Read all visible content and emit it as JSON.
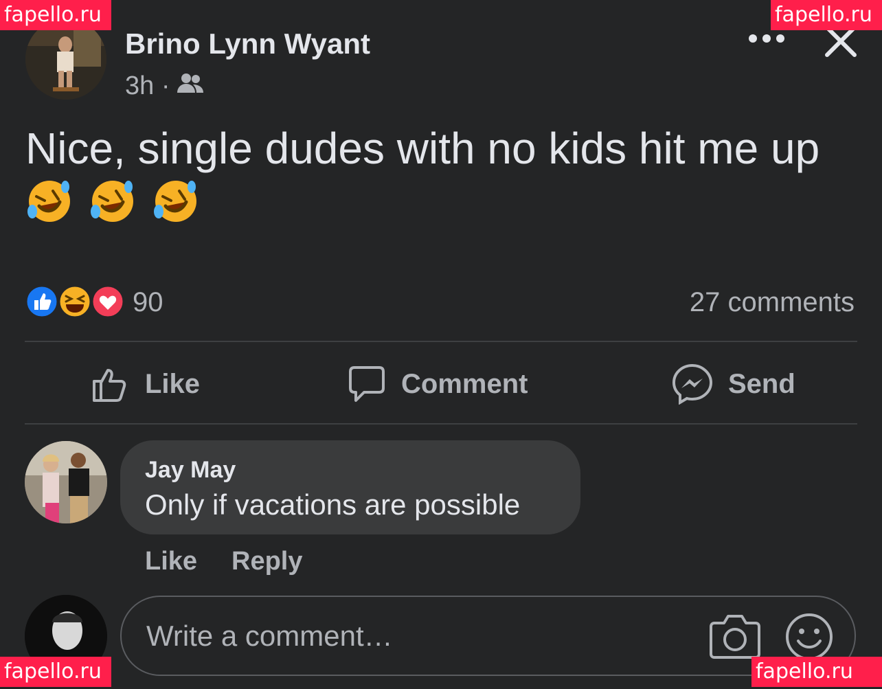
{
  "watermark": "fapello.ru",
  "post": {
    "author": "Brino Lynn Wyant",
    "time": "3h ·",
    "audience_icon": "friends-icon",
    "text": "Nice, single dudes with no kids hit me up",
    "emojis": [
      "rolling-on-floor-laughing",
      "rolling-on-floor-laughing",
      "rolling-on-floor-laughing"
    ],
    "reaction_count": "90",
    "reactions": [
      "like",
      "haha",
      "love"
    ],
    "comments_count": "27 comments"
  },
  "actions": {
    "like": "Like",
    "comment": "Comment",
    "send": "Send"
  },
  "comment": {
    "name": "Jay May",
    "text": "Only if vacations are possible",
    "like": "Like",
    "reply": "Reply"
  },
  "composer": {
    "placeholder": "Write a comment…"
  },
  "colors": {
    "background": "#242526",
    "bubble": "#3a3b3c",
    "text": "#e4e6eb",
    "secondary": "#b0b3b8",
    "like_blue": "#1877f2",
    "love_red": "#f33e58",
    "haha_yellow": "#f7b125",
    "watermark": "#ff1f4b"
  }
}
